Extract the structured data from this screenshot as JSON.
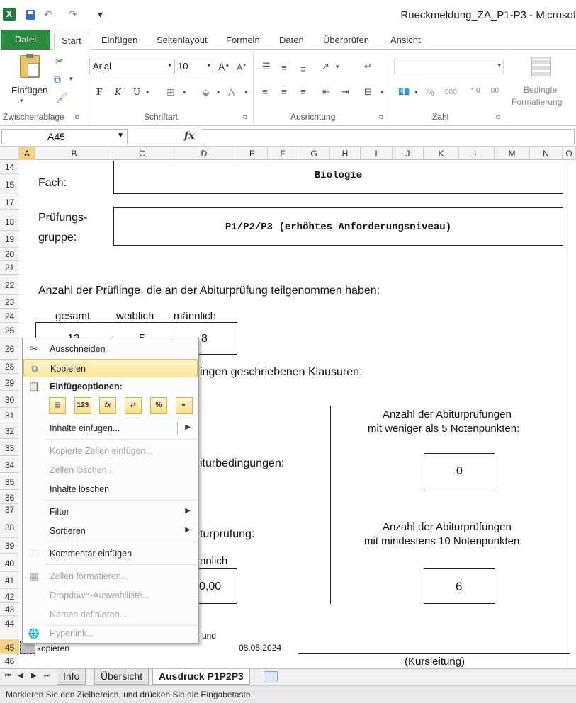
{
  "window": {
    "title": "Rueckmeldung_ZA_P1-P3 - Microsof"
  },
  "qat": {
    "undo": "↶",
    "redo": "↷",
    "more": "▾"
  },
  "ribbon_tabs": [
    "Datei",
    "Start",
    "Einfügen",
    "Seitenlayout",
    "Formeln",
    "Daten",
    "Überprüfen",
    "Ansicht"
  ],
  "ribbon": {
    "paste_label": "Einfügen",
    "clipboard_label": "Zwischenablage",
    "font_label": "Schriftart",
    "align_label": "Ausrichtung",
    "number_label": "Zahl",
    "font_name": "Arial",
    "font_size": "10",
    "bold": "F",
    "italic": "K",
    "underline": "U",
    "percent": "%",
    "thousands": "000",
    "cond_format_1": "Bedingte",
    "cond_format_2": "Formatierung"
  },
  "formula_bar": {
    "name_box": "A45",
    "fx": "fx",
    "formula": ""
  },
  "columns": [
    "A",
    "B",
    "C",
    "D",
    "E",
    "F",
    "G",
    "H",
    "I",
    "J",
    "K",
    "L",
    "M",
    "N",
    "O"
  ],
  "rows": [
    "14",
    "15",
    "17",
    "18",
    "19",
    "20",
    "21",
    "22",
    "23",
    "24",
    "25",
    "26",
    "28",
    "29",
    "30",
    "31",
    "32",
    "33",
    "34",
    "35",
    "36",
    "37",
    "38",
    "39",
    "40",
    "41",
    "42",
    "43",
    "44",
    "45",
    "46"
  ],
  "sheet": {
    "fach_label": "Fach:",
    "fach_value": "Biologie",
    "gruppe_label_1": "Prüfungs-",
    "gruppe_label_2": "gruppe:",
    "gruppe_value": "P1/P2/P3 (erhöhtes Anforderungsniveau)",
    "anzahl_text": "Anzahl der Prüflinge, die an der Abiturprüfung teilgenommen haben:",
    "col_gesamt": "gesamt",
    "col_weiblich": "weiblich",
    "col_maennlich": "männlich",
    "val_gesamt": "13",
    "val_weiblich": "5",
    "val_maennlich": "8",
    "klausuren_text": "ingen geschriebenen Klausuren:",
    "abitur_bed_text": "iturbedingungen:",
    "abitur_pruef_text": "turprüfung:",
    "maennlich_partial": "nnlich",
    "avg_partial": "0,00",
    "weniger_1": "Anzahl der Abiturprüfungen",
    "weniger_2": "mit weniger als 5 Notenpunkten:",
    "weniger_val": "0",
    "mindestens_1": "Anzahl der Abiturprüfungen",
    "mindestens_2": "mit mindestens 10 Notenpunkten:",
    "mindestens_val": "6",
    "und_text": "und",
    "kopieren_text": "kopieren",
    "date": "08.05.2024",
    "kursleitung": "(Kursleitung)"
  },
  "context_menu": {
    "ausschneiden": "Ausschneiden",
    "kopieren": "Kopieren",
    "einfuegeoptionen": "Einfügeoptionen:",
    "inhalte_einfuegen": "Inhalte einfügen...",
    "kopierte_zellen": "Kopierte Zellen einfügen...",
    "zellen_loeschen": "Zellen löschen...",
    "inhalte_loeschen": "Inhalte löschen",
    "filter": "Filter",
    "sortieren": "Sortieren",
    "kommentar": "Kommentar einfügen",
    "zellen_formatieren": "Zellen formatieren...",
    "dropdown": "Dropdown-Auswahlliste...",
    "namen": "Namen definieren...",
    "hyperlink": "Hyperlink...",
    "paste_icons": [
      "paste-icon",
      "values-icon",
      "formulas-icon",
      "transpose-icon",
      "formatting-icon",
      "link-icon"
    ],
    "paste_glyphs": [
      "▤",
      "123",
      "fx",
      "⇄",
      "%",
      "∞"
    ]
  },
  "sheet_tabs": [
    "Info",
    "Übersicht",
    "Ausdruck P1P2P3"
  ],
  "status_bar": {
    "text": "Markieren Sie den Zielbereich, und drücken Sie die Eingabetaste."
  },
  "colors": {
    "excel_green": "#2a8a3e",
    "selected_header": "#f5d48a",
    "menu_highlight": "#fde699"
  }
}
